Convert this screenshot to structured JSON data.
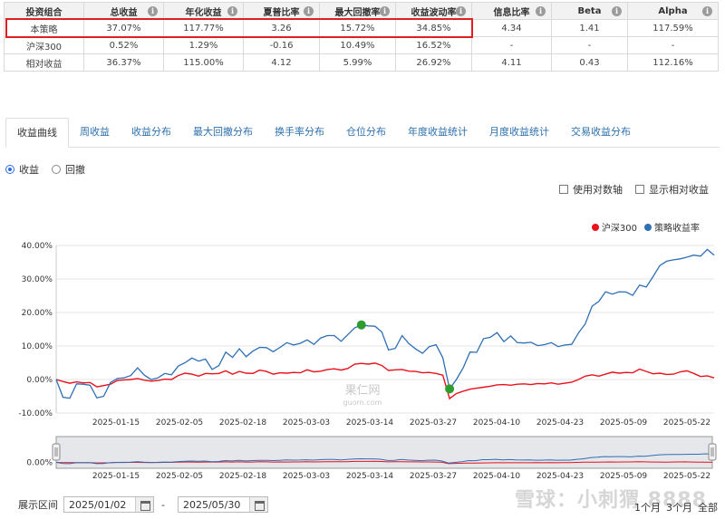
{
  "metrics": {
    "headers": [
      "投资组合",
      "总收益",
      "年化收益",
      "夏普比率",
      "最大回撤率",
      "收益波动率",
      "信息比率",
      "Beta",
      "Alpha"
    ],
    "rows": [
      [
        "本策略",
        "37.07%",
        "117.77%",
        "3.26",
        "15.72%",
        "34.85%",
        "4.34",
        "1.41",
        "117.59%"
      ],
      [
        "沪深300",
        "0.52%",
        "1.29%",
        "-0.16",
        "10.49%",
        "16.52%",
        "-",
        "-",
        "-"
      ],
      [
        "相对收益",
        "36.37%",
        "115.00%",
        "4.12",
        "5.99%",
        "26.92%",
        "4.11",
        "0.43",
        "112.16%"
      ]
    ],
    "info_icon": "i"
  },
  "tabs": [
    "收益曲线",
    "周收益",
    "收益分布",
    "最大回撤分布",
    "换手率分布",
    "仓位分布",
    "年度收益统计",
    "月度收益统计",
    "交易收益分布"
  ],
  "radios": {
    "option1": "收益",
    "option2": "回撤"
  },
  "checks": {
    "log_axis": "使用对数轴",
    "show_relative": "显示相对收益"
  },
  "legend": {
    "hs300": "沪深300",
    "strategy": "策略收益率",
    "hs300_color": "#e8111c",
    "strategy_color": "#2f6fb5"
  },
  "watermark_center": {
    "line1": "果仁网",
    "line2": "guorn.com"
  },
  "watermark_bottom": "雪球：小刺猬 8888",
  "range": {
    "label": "展示区间",
    "start": "2025/01/02",
    "sep": "-",
    "end": "2025/05/30"
  },
  "zoom": [
    "1个月",
    "3个月",
    "全部"
  ],
  "chart_data": {
    "type": "line",
    "x_tick_labels": [
      "2025-01-15",
      "2025-02-05",
      "2025-02-18",
      "2025-03-03",
      "2025-03-14",
      "2025-03-27",
      "2025-04-10",
      "2025-04-23",
      "2025-05-09",
      "2025-05-22"
    ],
    "y_tick_labels": [
      "40.00%",
      "30.00%",
      "20.00%",
      "10.00%",
      "0.00%",
      "-10.00%"
    ],
    "ylim": [
      -10,
      40
    ],
    "navigator_y_tick": "0.00%",
    "series": [
      {
        "name": "策略收益率",
        "color": "#2f6fb5",
        "values": [
          0.0,
          -5.3,
          -5.6,
          -1.3,
          -1.4,
          -1.7,
          -5.5,
          -5.0,
          -0.9,
          0.3,
          0.5,
          1.2,
          3.5,
          1.3,
          0.0,
          0.5,
          1.8,
          1.4,
          4.0,
          5.0,
          6.4,
          5.5,
          6.1,
          3.0,
          4.2,
          8.2,
          6.6,
          9.2,
          6.8,
          8.5,
          9.6,
          9.5,
          8.3,
          9.6,
          11.0,
          10.3,
          10.8,
          11.8,
          10.5,
          12.4,
          13.1,
          13.1,
          11.4,
          13.4,
          15.4,
          16.3,
          16.0,
          15.9,
          14.2,
          8.8,
          9.3,
          13.1,
          10.7,
          9.1,
          7.8,
          9.8,
          10.4,
          6.5,
          -2.8,
          0.0,
          3.5,
          8.2,
          8.1,
          12.2,
          12.6,
          14.0,
          11.3,
          13.0,
          11.0,
          10.9,
          11.1,
          10.1,
          10.4,
          11.0,
          9.8,
          10.3,
          10.5,
          13.9,
          16.6,
          21.9,
          23.3,
          26.2,
          25.5,
          26.2,
          26.1,
          25.1,
          28.2,
          27.6,
          30.7,
          34.0,
          35.3,
          35.7,
          36.0,
          36.5,
          37.1,
          36.8,
          38.8,
          37.1
        ]
      },
      {
        "name": "沪深300",
        "color": "#e8111c",
        "values": [
          0.0,
          -0.6,
          -1.1,
          -0.7,
          -1.0,
          -0.9,
          -2.2,
          -1.8,
          -1.4,
          -0.3,
          -0.1,
          0.0,
          0.3,
          -0.2,
          -0.5,
          -0.3,
          0.1,
          0.0,
          1.2,
          1.9,
          1.6,
          1.0,
          1.8,
          1.7,
          1.8,
          2.6,
          1.6,
          2.4,
          1.9,
          1.8,
          2.8,
          2.4,
          1.6,
          2.0,
          1.9,
          2.1,
          2.0,
          2.9,
          2.3,
          2.5,
          3.0,
          3.2,
          2.8,
          3.3,
          4.6,
          4.8,
          4.6,
          4.9,
          4.2,
          2.7,
          2.9,
          3.0,
          2.5,
          2.4,
          2.0,
          2.1,
          1.8,
          1.3,
          -5.7,
          -4.2,
          -3.5,
          -2.9,
          -2.6,
          -2.3,
          -2.0,
          -1.6,
          -1.5,
          -1.7,
          -1.4,
          -1.3,
          -1.5,
          -1.2,
          -1.3,
          -1.0,
          -1.4,
          -1.1,
          -0.8,
          0.0,
          1.0,
          1.4,
          1.0,
          1.6,
          2.2,
          1.9,
          2.1,
          2.0,
          3.1,
          2.4,
          1.7,
          1.9,
          1.5,
          1.6,
          2.3,
          2.6,
          1.8,
          0.9,
          1.1,
          0.5
        ]
      }
    ],
    "markers": [
      {
        "series": "策略收益率",
        "index": 45,
        "value": 16.3,
        "color": "#2e9c2e"
      },
      {
        "series": "策略收益率",
        "index": 58,
        "value": -2.8,
        "color": "#2e9c2e"
      }
    ]
  }
}
